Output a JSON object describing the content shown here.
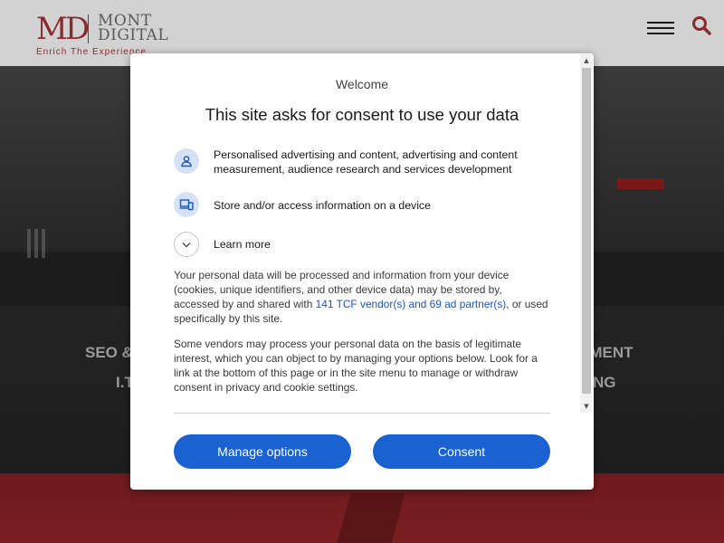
{
  "site": {
    "logo_letters": "MD",
    "logo_word1": "MONT",
    "logo_word2": "DIGITAL",
    "tagline": "Enrich The Experience",
    "hero_line1_left": "SEO &",
    "hero_line1_right": "PMENT",
    "hero_line2_left": "I.T",
    "hero_line2_right": "NG"
  },
  "consent": {
    "welcome": "Welcome",
    "title": "This site asks for consent to use your data",
    "purposes": [
      {
        "icon": "person-icon",
        "label": "Personalised advertising and content, advertising and content measurement, audience research and services development"
      },
      {
        "icon": "devices-icon",
        "label": "Store and/or access information on a device"
      },
      {
        "icon": "chevron-down-icon",
        "label": "Learn more"
      }
    ],
    "body1_pre": "Your personal data will be processed and information from your device (cookies, unique identifiers, and other device data) may be stored by, accessed by and shared with ",
    "body1_link": "141 TCF vendor(s) and 69 ad partner(s)",
    "body1_post": ", or used specifically by this site.",
    "body2": "Some vendors may process your personal data on the basis of legitimate interest, which you can object to by managing your options below. Look for a link at the bottom of this page or in the site menu to manage or withdraw consent in privacy and cookie settings.",
    "manage_label": "Manage options",
    "consent_label": "Consent"
  },
  "colors": {
    "brand": "#8e2a2d",
    "button": "#1a61d1",
    "link": "#1a56c4",
    "icon_bg": "#d4e2f4"
  }
}
